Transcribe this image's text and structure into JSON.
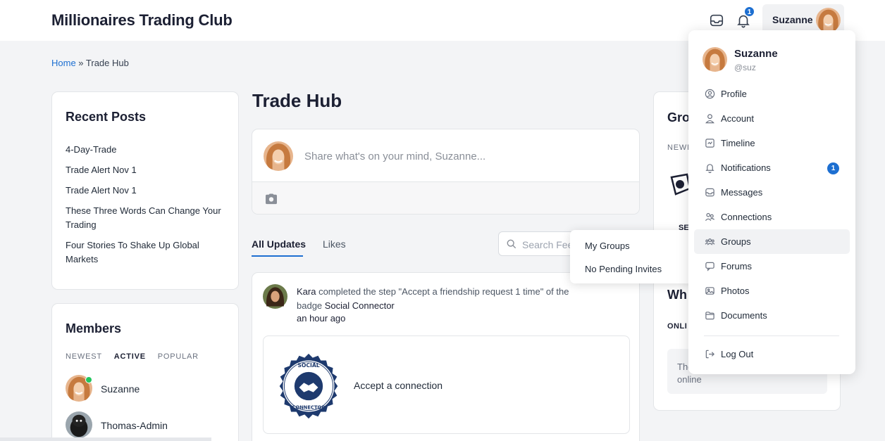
{
  "header": {
    "site_title": "Millionaires Trading Club",
    "notification_count": "1",
    "user_name": "Suzanne"
  },
  "breadcrumb": {
    "home": "Home",
    "separator": " » ",
    "current": "Trade Hub"
  },
  "recent_posts": {
    "title": "Recent Posts",
    "items": [
      "4-Day-Trade",
      "Trade Alert Nov 1",
      "Trade Alert Nov 1",
      "These Three Words Can Change Your Trading",
      "Four Stories To Shake Up Global Markets"
    ]
  },
  "members": {
    "title": "Members",
    "tabs": [
      "NEWEST",
      "ACTIVE",
      "POPULAR"
    ],
    "active_tab": "ACTIVE",
    "list": [
      "Suzanne",
      "Thomas-Admin"
    ]
  },
  "main": {
    "title": "Trade Hub",
    "composer_placeholder": "Share what's on your mind, Suzanne...",
    "tabs": [
      "All Updates",
      "Likes"
    ],
    "search_placeholder": "Search Feed",
    "groups_popup": [
      "My Groups",
      "No Pending Invites"
    ],
    "activity": {
      "user": "Kara",
      "text": " completed the step \"Accept a friendship request 1 time\" of the badge ",
      "badge": "Social Connector",
      "time": "an hour ago",
      "badge_label": "Accept a connection",
      "badge_ring_top": "SOCIAL",
      "badge_ring_bottom": "CONNECTOR"
    }
  },
  "right_sidebar": {
    "groups_title": "Gro",
    "groups_tab": "NEWE",
    "group_short": "SE",
    "whos_online_title": "Wh",
    "online_tab": "ONLI",
    "online_text": "The online"
  },
  "user_menu": {
    "name": "Suzanne",
    "handle": "@suz",
    "items": [
      {
        "label": "Profile",
        "icon": "user-circle-icon"
      },
      {
        "label": "Account",
        "icon": "user-icon"
      },
      {
        "label": "Timeline",
        "icon": "timeline-icon"
      },
      {
        "label": "Notifications",
        "icon": "bell-icon",
        "count": "1"
      },
      {
        "label": "Messages",
        "icon": "inbox-icon"
      },
      {
        "label": "Connections",
        "icon": "connections-icon"
      },
      {
        "label": "Groups",
        "icon": "groups-icon",
        "highlighted": true
      },
      {
        "label": "Forums",
        "icon": "chat-icon"
      },
      {
        "label": "Photos",
        "icon": "image-icon"
      },
      {
        "label": "Documents",
        "icon": "folder-icon"
      }
    ],
    "logout": "Log Out"
  },
  "colors": {
    "accent": "#1d6fd1",
    "online": "#22c55e",
    "badge_navy": "#1e3a6e",
    "page_bg": "#f3f4f6"
  }
}
